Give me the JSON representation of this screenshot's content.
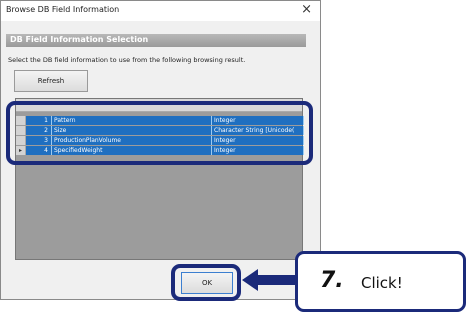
{
  "dialog": {
    "title": "Browse DB Field Information",
    "close_glyph": "×",
    "section_title": "DB Field Information Selection",
    "instruction": "Select the DB field information to use from the following browsing result.",
    "refresh_label": "Refresh",
    "ok_label": "OK"
  },
  "grid": {
    "rows": [
      {
        "indicator": "",
        "no": "1",
        "name": "Pattern",
        "type": "Integer"
      },
      {
        "indicator": "",
        "no": "2",
        "name": "Size",
        "type": "Character String [Unicode("
      },
      {
        "indicator": "",
        "no": "3",
        "name": "ProductionPlanVolume",
        "type": "Integer"
      },
      {
        "indicator": "▸",
        "no": "4",
        "name": "SpecifiedWeight",
        "type": "Integer"
      }
    ]
  },
  "callout": {
    "step": "7.",
    "text": "Click!"
  },
  "colors": {
    "highlight": "#1b2a7a",
    "selection": "#1f6fc0"
  }
}
